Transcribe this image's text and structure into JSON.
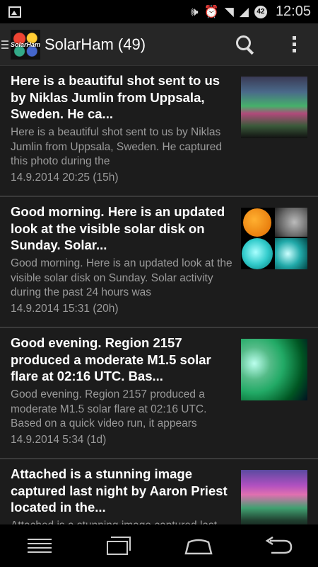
{
  "status_bar": {
    "time": "12:05",
    "battery_level": "42",
    "icons": [
      "image-notification-icon",
      "vibrate-icon",
      "alarm-icon",
      "wifi-icon",
      "signal-icon"
    ]
  },
  "action_bar": {
    "logo_text": "SolarHam",
    "title": "SolarHam (49)",
    "icons": [
      "drawer-menu-icon",
      "search-icon",
      "overflow-menu-icon"
    ]
  },
  "posts": [
    {
      "title": "Here is a beautiful shot sent to us by Niklas Jumlin from Uppsala, Sweden. He ca...",
      "snippet": "Here is a beautiful shot sent to us by Niklas Jumlin from Uppsala, Sweden. He captured this photo during the",
      "date": "14.9.2014 20:25 (15h)",
      "thumbnail": "aurora-photo"
    },
    {
      "title": "Good morning. Here is an updated look at the visible solar disk on Sunday. Solar...",
      "snippet": "Good morning. Here is an updated look at the visible solar disk on Sunday. Solar activity during the past 24 hours was",
      "date": "14.9.2014 15:31 (20h)",
      "thumbnail": "solar-disk-collage"
    },
    {
      "title": "Good evening. Region 2157 produced a moderate M1.5 solar flare at 02:16 UTC. Bas...",
      "snippet": "Good evening. Region 2157 produced a moderate M1.5 solar flare at 02:16 UTC. Based on a quick video run, it appears",
      "date": "14.9.2014 5:34 (1d)",
      "thumbnail": "solar-flare-image"
    },
    {
      "title": "Attached is a stunning image captured last night by Aaron Priest located in the...",
      "snippet": "Attached is a stunning image captured last night by Aaron Priest located in the",
      "date": "",
      "thumbnail": "aurora-photo-2"
    }
  ],
  "nav_bar": {
    "icons": [
      "menu-icon",
      "recent-apps-icon",
      "home-icon",
      "back-icon"
    ]
  }
}
